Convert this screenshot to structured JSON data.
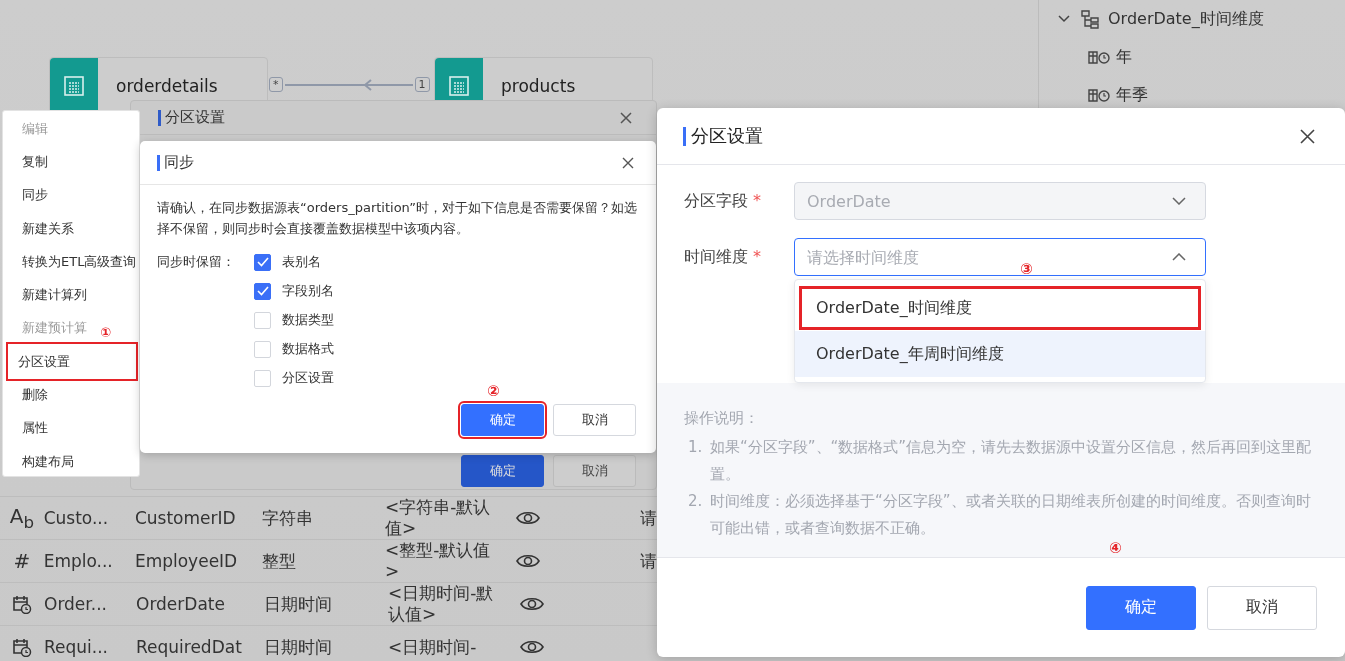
{
  "model_canvas": {
    "nodes": [
      {
        "name": "orderdetails"
      },
      {
        "name": "products"
      }
    ],
    "relation": {
      "many_mark": "*",
      "one_mark": "1"
    }
  },
  "dimension_tree": {
    "label": "OrderDate_时间维度",
    "expanded": true,
    "children": [
      {
        "label": "年"
      },
      {
        "label": "年季"
      }
    ]
  },
  "background_dialog": {
    "title": "分区设置",
    "buttons": [
      {
        "label": "确定",
        "kind": "primary"
      },
      {
        "label": "取消",
        "kind": "secondary"
      }
    ]
  },
  "field_table": {
    "rows": [
      {
        "kind": "text",
        "icon_text": "A$_{b}$",
        "column_1": "Custo...",
        "column_2": "CustomerID",
        "column_3": "字符串",
        "column_4": "<字符串-默认值>",
        "visible": true,
        "column_6": "请"
      },
      {
        "kind": "number",
        "icon_text": "#",
        "column_1": "Emplo...",
        "column_2": "EmployeeID",
        "column_3": "整型",
        "column_4": "<整型-默认值>",
        "visible": true,
        "column_6": "请"
      },
      {
        "kind": "datetime",
        "column_1": "Order...",
        "column_2": "OrderDate",
        "column_3": "日期时间",
        "column_4": "<日期时间-默认值>",
        "visible": true
      },
      {
        "kind": "datetime",
        "column_1": "Requi...",
        "column_2": "RequiredDat",
        "column_3": "日期时间",
        "column_4": "<日期时间-",
        "visible": true
      }
    ]
  },
  "context_menu": {
    "step_mark": "①",
    "items": [
      {
        "label": "编辑",
        "disabled": true,
        "highlighted": false
      },
      {
        "label": "复制",
        "disabled": false,
        "highlighted": false
      },
      {
        "label": "同步",
        "disabled": false,
        "highlighted": false
      },
      {
        "label": "新建关系",
        "disabled": false,
        "highlighted": false
      },
      {
        "label": "转换为ETL高级查询",
        "disabled": false,
        "highlighted": false
      },
      {
        "label": "新建计算列",
        "disabled": false,
        "highlighted": false
      },
      {
        "label": "新建预计算",
        "disabled": true,
        "highlighted": false
      },
      {
        "label": "分区设置",
        "disabled": false,
        "highlighted": true
      },
      {
        "label": "删除",
        "disabled": false,
        "highlighted": false
      },
      {
        "label": "属性",
        "disabled": false,
        "highlighted": false
      },
      {
        "label": "构建布局",
        "disabled": false,
        "highlighted": false
      }
    ]
  },
  "sync_dialog": {
    "title": "同步",
    "message": "请确认，在同步数据源表“orders_partition”时，对于如下信息是否需要保留？如选择不保留，则同步时会直接覆盖数据模型中该项内容。",
    "keep_label": "同步时保留：",
    "step_mark": "②",
    "options": [
      {
        "label": "表别名",
        "checked": true
      },
      {
        "label": "字段别名",
        "checked": true
      },
      {
        "label": "数据类型",
        "checked": false
      },
      {
        "label": "数据格式",
        "checked": false
      },
      {
        "label": "分区设置",
        "checked": false
      }
    ],
    "buttons": [
      {
        "label": "确定",
        "kind": "primary",
        "highlighted": true
      },
      {
        "label": "取消",
        "kind": "secondary",
        "highlighted": false
      }
    ]
  },
  "partition_dialog": {
    "title": "分区设置",
    "fields": [
      {
        "label": "分区字段",
        "required": true,
        "value": "OrderDate",
        "disabled": true,
        "open": false
      },
      {
        "label": "时间维度",
        "required": true,
        "placeholder": "请选择时间维度",
        "disabled": false,
        "open": true,
        "step_mark": "③",
        "options": [
          {
            "label": "OrderDate_时间维度",
            "highlighted": true,
            "hovered": false
          },
          {
            "label": "OrderDate_年周时间维度",
            "highlighted": false,
            "hovered": true
          }
        ]
      }
    ],
    "notes": {
      "title": "操作说明：",
      "items": [
        {
          "number": "1.",
          "text": "如果“分区字段”、“数据格式”信息为空，请先去数据源中设置分区信息，然后再回到这里配置。"
        },
        {
          "number": "2.",
          "text": "时间维度：必须选择基于“分区字段”、或者关联的日期维表所创建的时间维度。否则查询时可能出错，或者查询数据不正确。"
        }
      ]
    },
    "step_mark": "④",
    "buttons": [
      {
        "label": "确定",
        "kind": "primary"
      },
      {
        "label": "取消",
        "kind": "secondary"
      }
    ]
  }
}
